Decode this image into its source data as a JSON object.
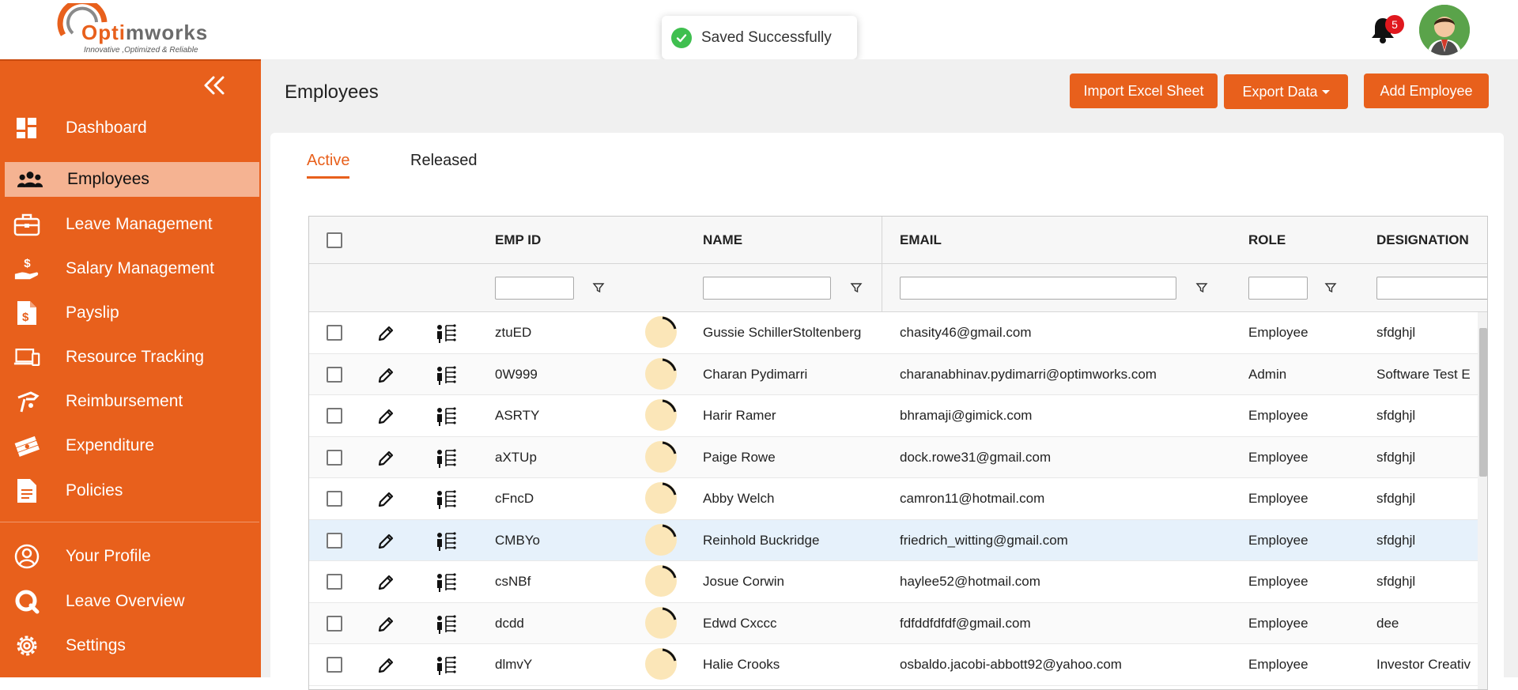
{
  "brand": {
    "name_part1": "Opti",
    "name_part2": "mworks",
    "tagline": "Innovative ,Optimized & Reliable"
  },
  "toast": {
    "message": "Saved Successfully",
    "status_color": "#3fbf4f"
  },
  "header": {
    "notification_count": "5"
  },
  "sidebar": {
    "items": [
      {
        "label": "Dashboard",
        "icon": "dashboard-icon"
      },
      {
        "label": "Employees",
        "icon": "employees-icon",
        "active": true
      },
      {
        "label": "Leave Management",
        "icon": "briefcase-icon"
      },
      {
        "label": "Salary Management",
        "icon": "salary-hand-icon"
      },
      {
        "label": "Payslip",
        "icon": "payslip-icon"
      },
      {
        "label": "Resource Tracking",
        "icon": "devices-icon"
      },
      {
        "label": "Reimbursement",
        "icon": "reimbursement-icon"
      },
      {
        "label": "Expenditure",
        "icon": "money-stack-icon"
      },
      {
        "label": "Policies",
        "icon": "document-icon"
      }
    ],
    "bottom_items": [
      {
        "label": "Your Profile",
        "icon": "user-circle-icon"
      },
      {
        "label": "Leave Overview",
        "icon": "leave-overview-icon"
      },
      {
        "label": "Settings",
        "icon": "gear-icon"
      }
    ]
  },
  "page": {
    "title": "Employees"
  },
  "toolbar": {
    "import_label": "Import Excel Sheet",
    "export_label": "Export Data",
    "add_label": "Add Employee"
  },
  "tabs": [
    {
      "label": "Active",
      "active": true
    },
    {
      "label": "Released"
    }
  ],
  "table": {
    "headers": {
      "emp_id": "EMP ID",
      "name": "NAME",
      "email": "EMAIL",
      "role": "ROLE",
      "designation": "DESIGNATION"
    },
    "rows": [
      {
        "emp_id": "ztuED",
        "name": "Gussie SchillerStoltenberg",
        "email": "chasity46@gmail.com",
        "role": "Employee",
        "designation": "sfdghjl"
      },
      {
        "emp_id": "0W999",
        "name": "Charan Pydimarri",
        "email": "charanabhinav.pydimarri@optimworks.com",
        "role": "Admin",
        "designation": "Software Test E"
      },
      {
        "emp_id": "ASRTY",
        "name": "Harir Ramer",
        "email": "bhramaji@gimick.com",
        "role": "Employee",
        "designation": "sfdghjl"
      },
      {
        "emp_id": "aXTUp",
        "name": "Paige Rowe",
        "email": "dock.rowe31@gmail.com",
        "role": "Employee",
        "designation": "sfdghjl"
      },
      {
        "emp_id": "cFncD",
        "name": "Abby Welch",
        "email": "camron11@hotmail.com",
        "role": "Employee",
        "designation": "sfdghjl"
      },
      {
        "emp_id": "CMBYo",
        "name": "Reinhold Buckridge",
        "email": "friedrich_witting@gmail.com",
        "role": "Employee",
        "designation": "sfdghjl",
        "selected": true
      },
      {
        "emp_id": "csNBf",
        "name": "Josue Corwin",
        "email": "haylee52@hotmail.com",
        "role": "Employee",
        "designation": "sfdghjl"
      },
      {
        "emp_id": "dcdd",
        "name": "Edwd Cxccc",
        "email": "fdfddfdfdf@gmail.com",
        "role": "Employee",
        "designation": "dee"
      },
      {
        "emp_id": "dlmvY",
        "name": "Halie Crooks",
        "email": "osbaldo.jacobi-abbott92@yahoo.com",
        "role": "Employee",
        "designation": "Investor Creativ"
      }
    ]
  },
  "colors": {
    "brand": "#e8601c",
    "active_nav": "#f5b392",
    "selected_row": "#e6f1fb",
    "badge": "#e0181e"
  }
}
